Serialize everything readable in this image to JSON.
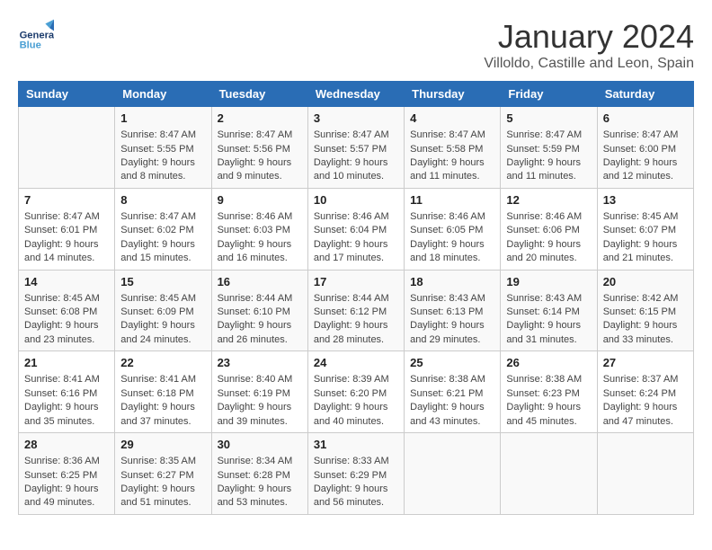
{
  "header": {
    "logo_general": "General",
    "logo_blue": "Blue",
    "month_title": "January 2024",
    "location": "Villoldo, Castille and Leon, Spain"
  },
  "days_of_week": [
    "Sunday",
    "Monday",
    "Tuesday",
    "Wednesday",
    "Thursday",
    "Friday",
    "Saturday"
  ],
  "weeks": [
    [
      {
        "day": "",
        "empty": true
      },
      {
        "day": "1",
        "sunrise": "Sunrise: 8:47 AM",
        "sunset": "Sunset: 5:55 PM",
        "daylight": "Daylight: 9 hours and 8 minutes."
      },
      {
        "day": "2",
        "sunrise": "Sunrise: 8:47 AM",
        "sunset": "Sunset: 5:56 PM",
        "daylight": "Daylight: 9 hours and 9 minutes."
      },
      {
        "day": "3",
        "sunrise": "Sunrise: 8:47 AM",
        "sunset": "Sunset: 5:57 PM",
        "daylight": "Daylight: 9 hours and 10 minutes."
      },
      {
        "day": "4",
        "sunrise": "Sunrise: 8:47 AM",
        "sunset": "Sunset: 5:58 PM",
        "daylight": "Daylight: 9 hours and 11 minutes."
      },
      {
        "day": "5",
        "sunrise": "Sunrise: 8:47 AM",
        "sunset": "Sunset: 5:59 PM",
        "daylight": "Daylight: 9 hours and 11 minutes."
      },
      {
        "day": "6",
        "sunrise": "Sunrise: 8:47 AM",
        "sunset": "Sunset: 6:00 PM",
        "daylight": "Daylight: 9 hours and 12 minutes."
      }
    ],
    [
      {
        "day": "7",
        "sunrise": "Sunrise: 8:47 AM",
        "sunset": "Sunset: 6:01 PM",
        "daylight": "Daylight: 9 hours and 14 minutes."
      },
      {
        "day": "8",
        "sunrise": "Sunrise: 8:47 AM",
        "sunset": "Sunset: 6:02 PM",
        "daylight": "Daylight: 9 hours and 15 minutes."
      },
      {
        "day": "9",
        "sunrise": "Sunrise: 8:46 AM",
        "sunset": "Sunset: 6:03 PM",
        "daylight": "Daylight: 9 hours and 16 minutes."
      },
      {
        "day": "10",
        "sunrise": "Sunrise: 8:46 AM",
        "sunset": "Sunset: 6:04 PM",
        "daylight": "Daylight: 9 hours and 17 minutes."
      },
      {
        "day": "11",
        "sunrise": "Sunrise: 8:46 AM",
        "sunset": "Sunset: 6:05 PM",
        "daylight": "Daylight: 9 hours and 18 minutes."
      },
      {
        "day": "12",
        "sunrise": "Sunrise: 8:46 AM",
        "sunset": "Sunset: 6:06 PM",
        "daylight": "Daylight: 9 hours and 20 minutes."
      },
      {
        "day": "13",
        "sunrise": "Sunrise: 8:45 AM",
        "sunset": "Sunset: 6:07 PM",
        "daylight": "Daylight: 9 hours and 21 minutes."
      }
    ],
    [
      {
        "day": "14",
        "sunrise": "Sunrise: 8:45 AM",
        "sunset": "Sunset: 6:08 PM",
        "daylight": "Daylight: 9 hours and 23 minutes."
      },
      {
        "day": "15",
        "sunrise": "Sunrise: 8:45 AM",
        "sunset": "Sunset: 6:09 PM",
        "daylight": "Daylight: 9 hours and 24 minutes."
      },
      {
        "day": "16",
        "sunrise": "Sunrise: 8:44 AM",
        "sunset": "Sunset: 6:10 PM",
        "daylight": "Daylight: 9 hours and 26 minutes."
      },
      {
        "day": "17",
        "sunrise": "Sunrise: 8:44 AM",
        "sunset": "Sunset: 6:12 PM",
        "daylight": "Daylight: 9 hours and 28 minutes."
      },
      {
        "day": "18",
        "sunrise": "Sunrise: 8:43 AM",
        "sunset": "Sunset: 6:13 PM",
        "daylight": "Daylight: 9 hours and 29 minutes."
      },
      {
        "day": "19",
        "sunrise": "Sunrise: 8:43 AM",
        "sunset": "Sunset: 6:14 PM",
        "daylight": "Daylight: 9 hours and 31 minutes."
      },
      {
        "day": "20",
        "sunrise": "Sunrise: 8:42 AM",
        "sunset": "Sunset: 6:15 PM",
        "daylight": "Daylight: 9 hours and 33 minutes."
      }
    ],
    [
      {
        "day": "21",
        "sunrise": "Sunrise: 8:41 AM",
        "sunset": "Sunset: 6:16 PM",
        "daylight": "Daylight: 9 hours and 35 minutes."
      },
      {
        "day": "22",
        "sunrise": "Sunrise: 8:41 AM",
        "sunset": "Sunset: 6:18 PM",
        "daylight": "Daylight: 9 hours and 37 minutes."
      },
      {
        "day": "23",
        "sunrise": "Sunrise: 8:40 AM",
        "sunset": "Sunset: 6:19 PM",
        "daylight": "Daylight: 9 hours and 39 minutes."
      },
      {
        "day": "24",
        "sunrise": "Sunrise: 8:39 AM",
        "sunset": "Sunset: 6:20 PM",
        "daylight": "Daylight: 9 hours and 40 minutes."
      },
      {
        "day": "25",
        "sunrise": "Sunrise: 8:38 AM",
        "sunset": "Sunset: 6:21 PM",
        "daylight": "Daylight: 9 hours and 43 minutes."
      },
      {
        "day": "26",
        "sunrise": "Sunrise: 8:38 AM",
        "sunset": "Sunset: 6:23 PM",
        "daylight": "Daylight: 9 hours and 45 minutes."
      },
      {
        "day": "27",
        "sunrise": "Sunrise: 8:37 AM",
        "sunset": "Sunset: 6:24 PM",
        "daylight": "Daylight: 9 hours and 47 minutes."
      }
    ],
    [
      {
        "day": "28",
        "sunrise": "Sunrise: 8:36 AM",
        "sunset": "Sunset: 6:25 PM",
        "daylight": "Daylight: 9 hours and 49 minutes."
      },
      {
        "day": "29",
        "sunrise": "Sunrise: 8:35 AM",
        "sunset": "Sunset: 6:27 PM",
        "daylight": "Daylight: 9 hours and 51 minutes."
      },
      {
        "day": "30",
        "sunrise": "Sunrise: 8:34 AM",
        "sunset": "Sunset: 6:28 PM",
        "daylight": "Daylight: 9 hours and 53 minutes."
      },
      {
        "day": "31",
        "sunrise": "Sunrise: 8:33 AM",
        "sunset": "Sunset: 6:29 PM",
        "daylight": "Daylight: 9 hours and 56 minutes."
      },
      {
        "day": "",
        "empty": true
      },
      {
        "day": "",
        "empty": true
      },
      {
        "day": "",
        "empty": true
      }
    ]
  ]
}
